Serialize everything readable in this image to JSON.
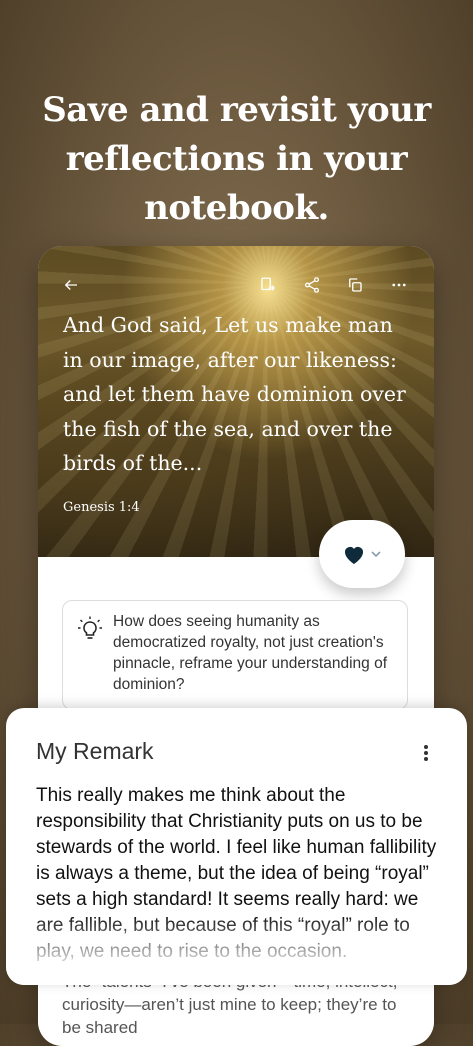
{
  "headline": "Save and revisit your reflections in your notebook.",
  "card": {
    "verse": "And God said, Let us make man in our image, after our likeness: and let  them have dominion over the fish of the sea, and over the birds of the...",
    "reference": "Genesis 1:4",
    "toolbar_icons": [
      "back-arrow-icon",
      "notebook-export-icon",
      "share-icon",
      "copy-icon",
      "more-horizontal-icon"
    ],
    "reaction": {
      "icon": "heart-icon",
      "color": "#0f2a3a"
    },
    "question": "How does seeing humanity as democratized royalty, not just creation's pinnacle, reframe your understanding of dominion?",
    "behind_text": "The “talents” I’ve been given—time, intellect, curiosity—aren’t just mine to keep; they’re to be shared"
  },
  "sheet": {
    "title": "My Remark",
    "remark": "This really makes me think about the responsibility that Christianity puts on us to be stewards of the world. I feel like human fallibility is always a theme, but the idea of being “royal” sets a high standard! It seems really hard: we are fallible, but because of this “royal” role to play, we need to rise to the occasion."
  }
}
